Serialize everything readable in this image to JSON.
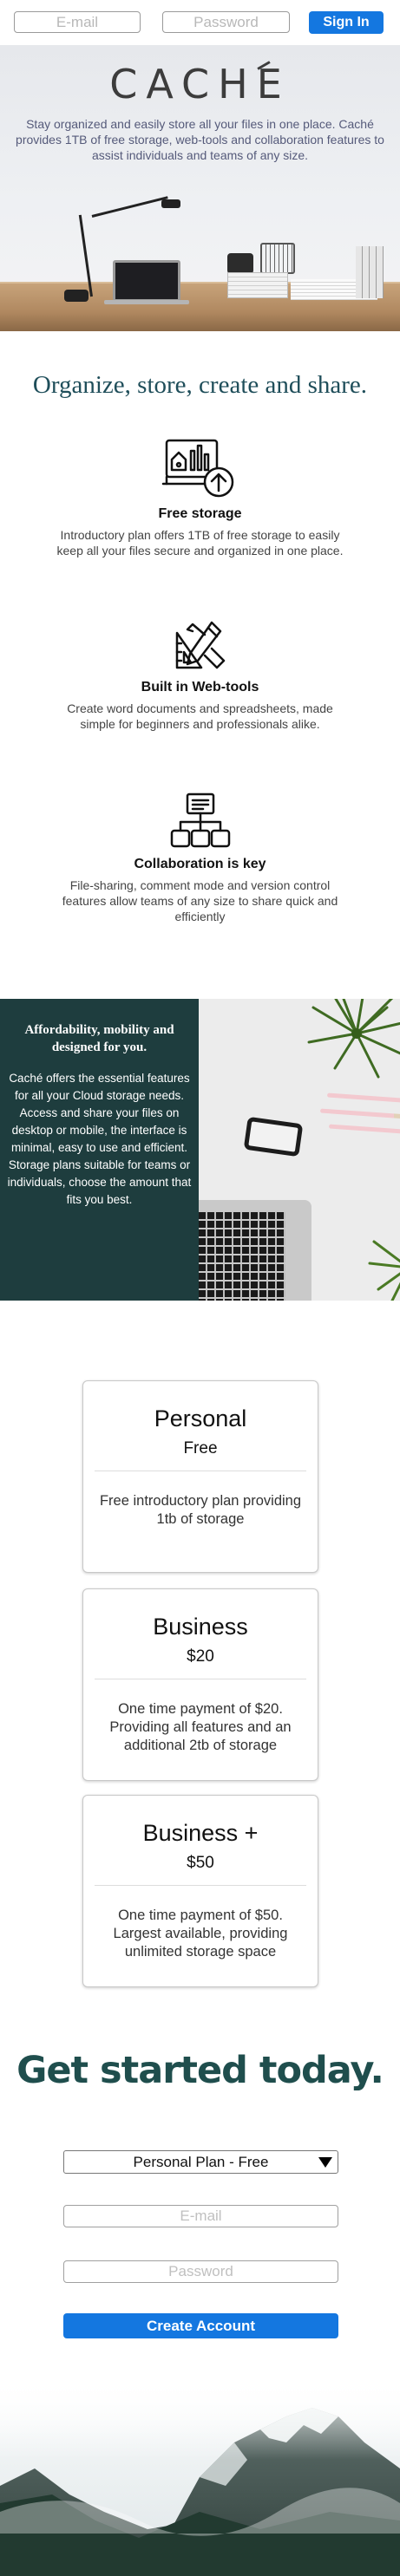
{
  "topbar": {
    "email_placeholder": "E-mail",
    "password_placeholder": "Password",
    "signin_label": "Sign In"
  },
  "hero": {
    "logo": "CACHE",
    "tagline": "Stay organized and easily store all your files in one place. Caché provides 1TB of free storage, web-tools and collaboration features to assist individuals and teams of any size."
  },
  "features": {
    "title": "Organize, store, create and share.",
    "items": [
      {
        "icon": "cloud-storage-icon",
        "title": "Free storage",
        "desc": "Introductory plan offers 1TB of free storage to easily keep all your files secure and organized in one place."
      },
      {
        "icon": "design-tools-icon",
        "title": "Built in Web-tools",
        "desc": "Create word documents and spreadsheets, made simple for beginners and professionals alike."
      },
      {
        "icon": "network-icon",
        "title": "Collaboration is key",
        "desc": "File-sharing, comment mode and version control features allow teams of any size to share quick and efficiently"
      }
    ]
  },
  "afford": {
    "heading": "Affordability, mobility and designed for you.",
    "body": "Caché offers the essential features for all your Cloud storage needs. Access and share your files on desktop or mobile, the interface is minimal, easy to use and efficient. Storage plans suitable for teams or individuals, choose the amount that fits you best."
  },
  "pricing": [
    {
      "name": "Personal",
      "price": "Free",
      "desc": "Free introductory plan providing 1tb of storage"
    },
    {
      "name": "Business",
      "price": "$20",
      "desc": "One time payment of $20. Providing all features and an additional 2tb of storage"
    },
    {
      "name": "Business +",
      "price": "$50",
      "desc": "One time payment of $50. Largest available, providing unlimited storage space"
    }
  ],
  "signup": {
    "title": "Get started today.",
    "plan_selected": "Personal Plan - Free",
    "email_placeholder": "E-mail",
    "password_placeholder": "Password",
    "button_label": "Create Account"
  },
  "colors": {
    "accent": "#1477e0",
    "dark_teal": "#1e3d3e",
    "heading_teal": "#1f4e5a"
  }
}
